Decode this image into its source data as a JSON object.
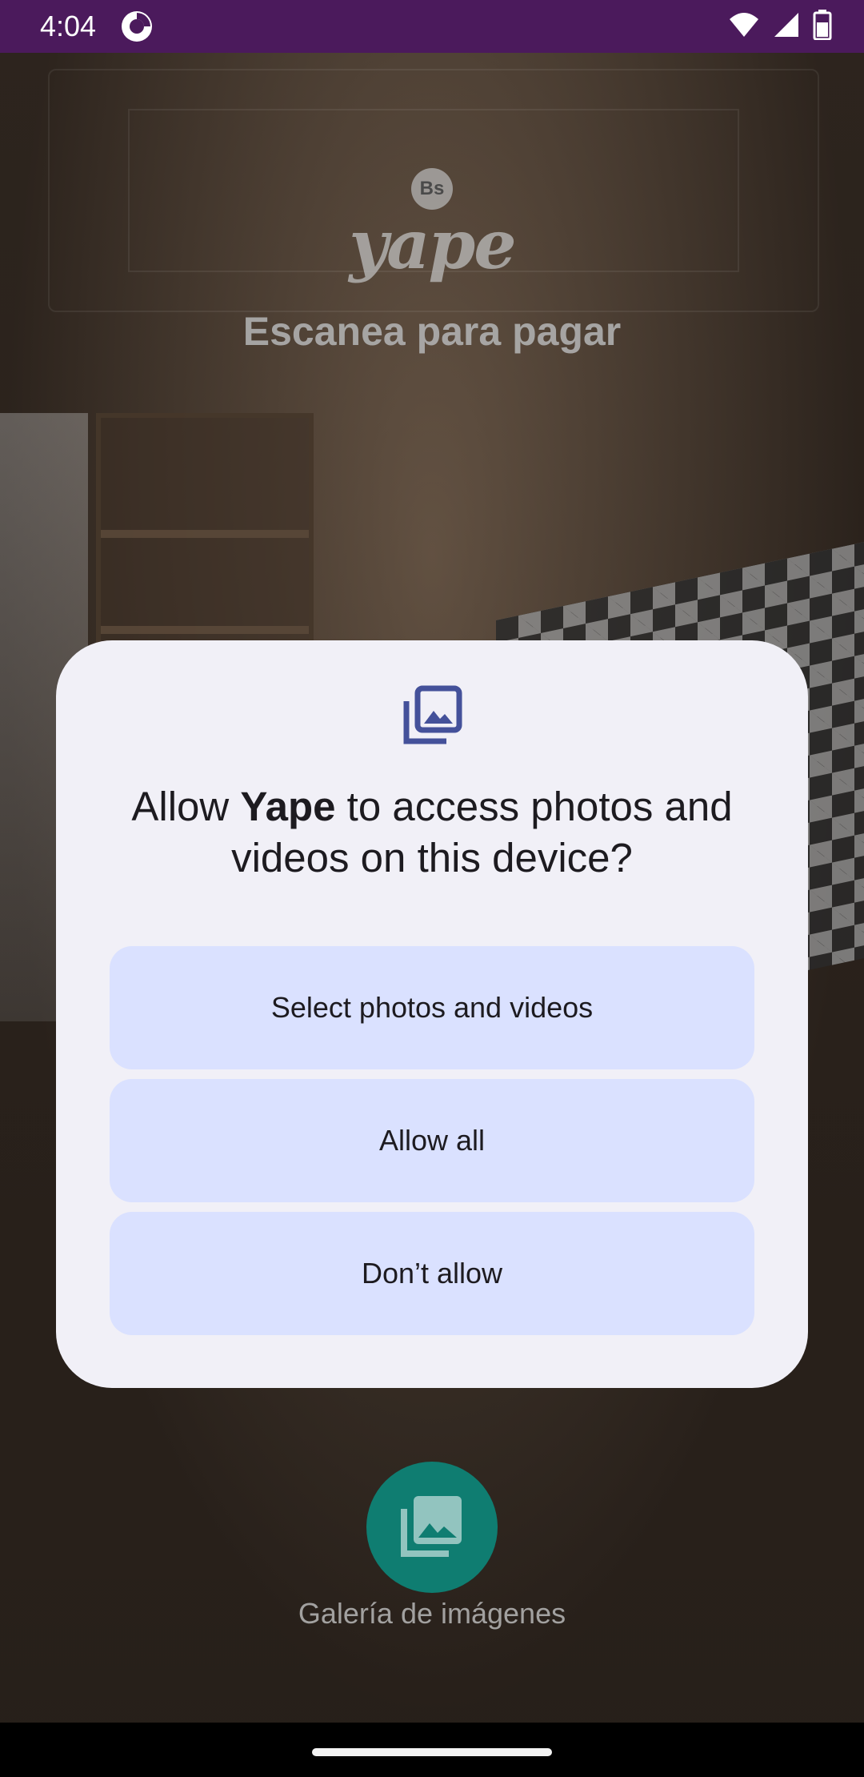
{
  "status_bar": {
    "time": "4:04",
    "icons": [
      "app-sync-icon",
      "wifi-icon",
      "signal-icon",
      "battery-icon"
    ]
  },
  "app": {
    "logo_badge": "Bs",
    "logo_text": "yape",
    "scan_title": "Escanea para pagar",
    "gallery_label": "Galería de imágenes"
  },
  "dialog": {
    "icon": "photo-library-icon",
    "title_prefix": "Allow ",
    "title_app": "Yape",
    "title_suffix": " to access photos and videos on this device?",
    "buttons": {
      "select": "Select photos and videos",
      "allow_all": "Allow all",
      "dont_allow": "Don’t allow"
    }
  },
  "colors": {
    "status_bar": "#4b1a5c",
    "dialog_bg": "#f1f0f7",
    "button_bg": "#dae1ff",
    "gallery_button": "#0f7d71"
  }
}
